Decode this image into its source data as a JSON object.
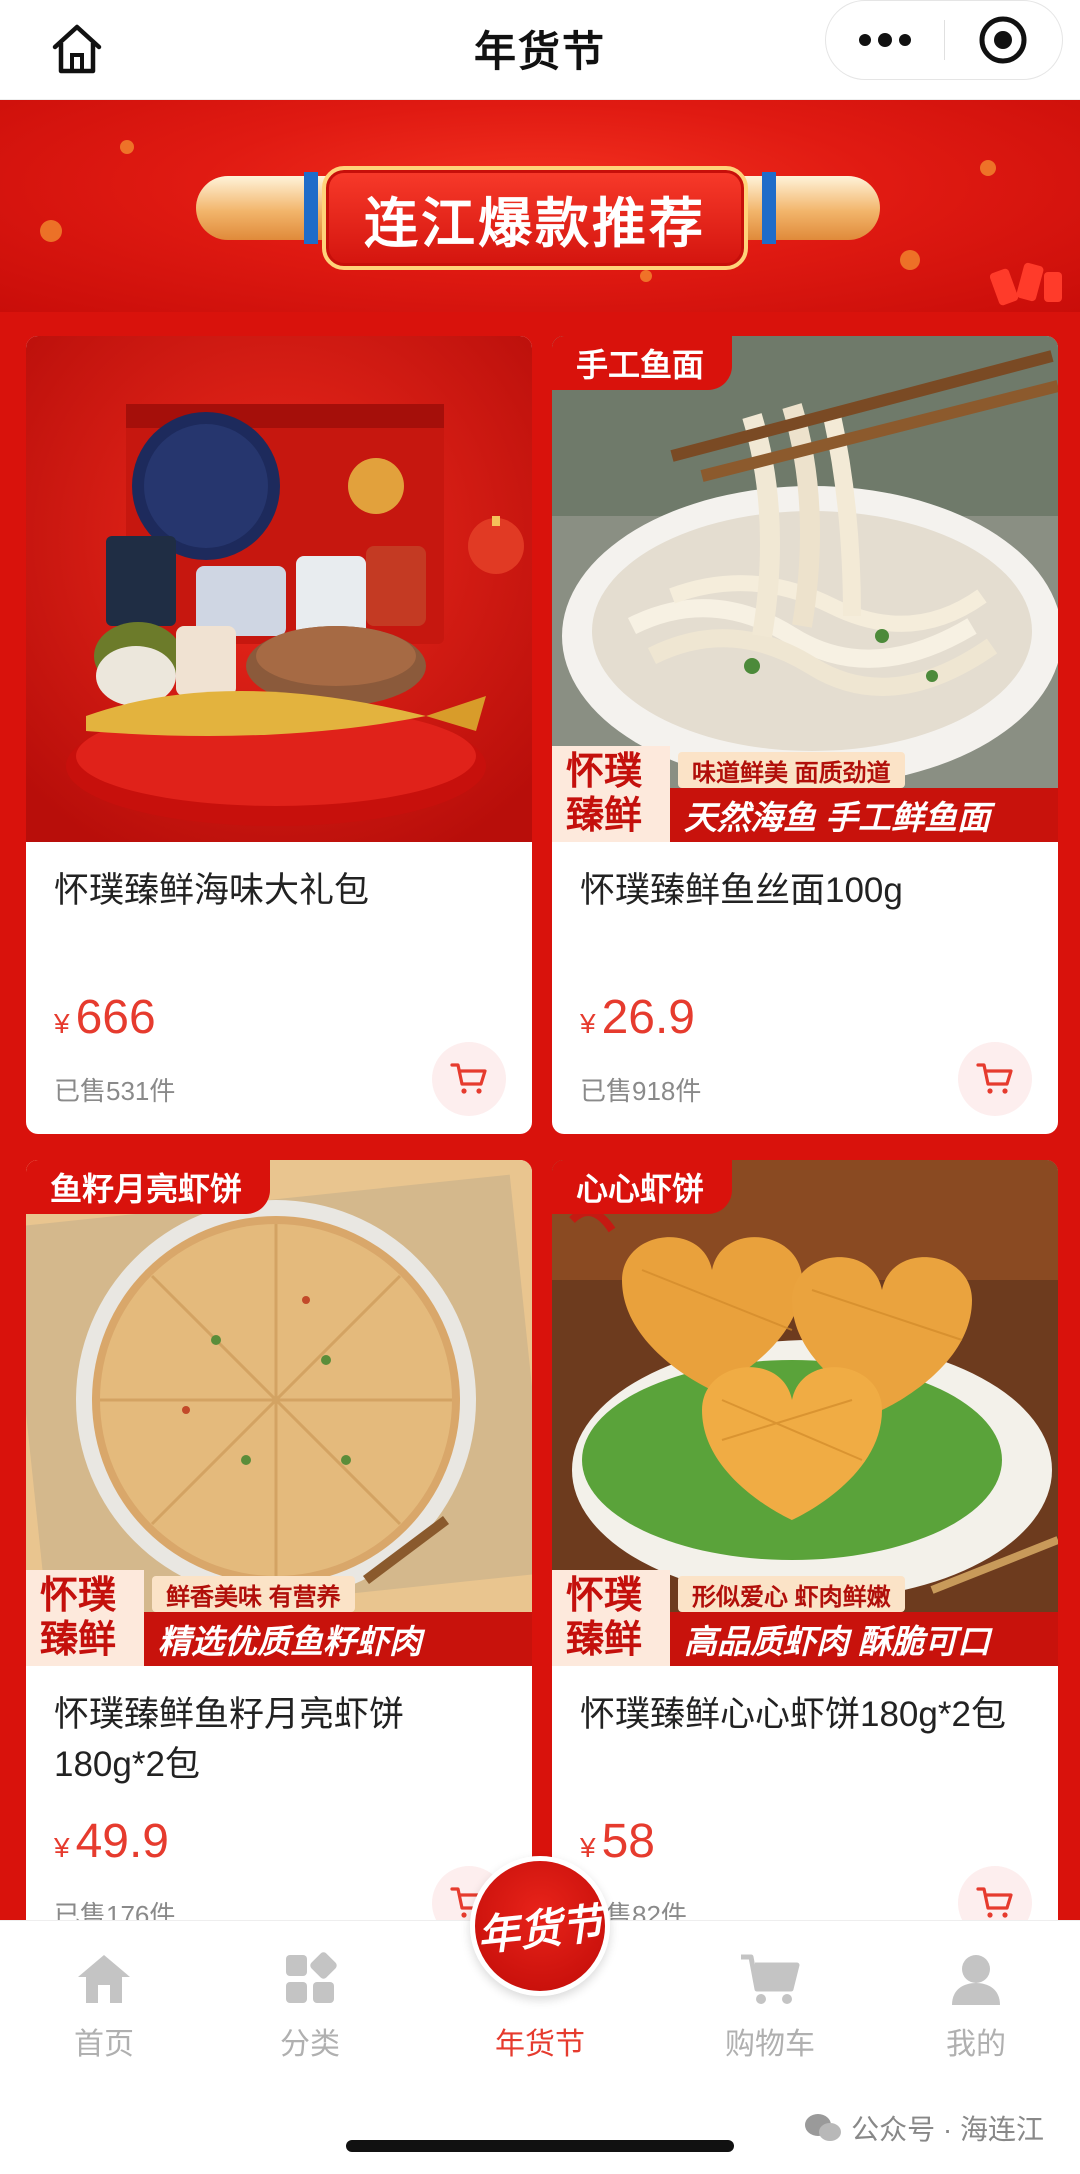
{
  "header": {
    "title": "年货节"
  },
  "banner": {
    "title": "连江爆款推荐"
  },
  "products": [
    {
      "name": "怀璞臻鲜海味大礼包",
      "currency": "¥",
      "price": "666",
      "sold": "已售531件",
      "tag": "",
      "promo_brand": "",
      "promo_sub": "",
      "promo_main": ""
    },
    {
      "name": "怀璞臻鲜鱼丝面100g",
      "currency": "¥",
      "price": "26.9",
      "sold": "已售918件",
      "tag": "手工鱼面",
      "promo_brand": "怀璞臻鲜",
      "promo_sub": "味道鲜美 面质劲道",
      "promo_main": "天然海鱼 手工鲜鱼面"
    },
    {
      "name": "怀璞臻鲜鱼籽月亮虾饼180g*2包",
      "currency": "¥",
      "price": "49.9",
      "sold": "已售176件",
      "tag": "鱼籽月亮虾饼",
      "promo_brand": "怀璞臻鲜",
      "promo_sub": "鲜香美味 有营养",
      "promo_main": "精选优质鱼籽虾肉"
    },
    {
      "name": "怀璞臻鲜心心虾饼180g*2包",
      "currency": "¥",
      "price": "58",
      "sold": "已售82件",
      "tag": "心心虾饼",
      "promo_brand": "怀璞臻鲜",
      "promo_sub": "形似爱心 虾肉鲜嫩",
      "promo_main": "高品质虾肉 酥脆可口"
    }
  ],
  "tabbar": {
    "items": [
      {
        "label": "首页",
        "icon": "home-icon"
      },
      {
        "label": "分类",
        "icon": "category-icon"
      },
      {
        "label": "年货节",
        "icon": "festival-badge-icon"
      },
      {
        "label": "购物车",
        "icon": "cart-icon"
      },
      {
        "label": "我的",
        "icon": "profile-icon"
      }
    ],
    "active_index": 2,
    "center_badge_text": "年货节"
  },
  "watermark": {
    "text": "公众号 · 海连江"
  },
  "colors": {
    "brand_red": "#d9120c",
    "price_red": "#e63b2e",
    "inactive_gray": "#b0b0b0"
  }
}
